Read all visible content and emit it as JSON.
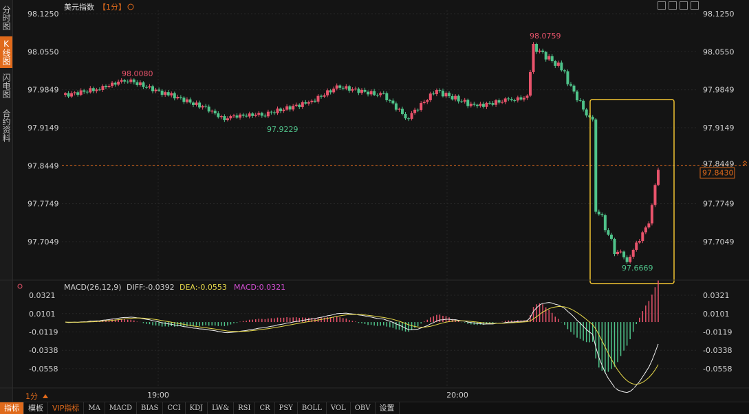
{
  "sidebar": {
    "tabs": [
      {
        "label": "分时图",
        "active": false
      },
      {
        "label": "K线图",
        "active": true
      },
      {
        "label": "闪电图",
        "active": false
      },
      {
        "label": "合约资料",
        "active": false
      }
    ]
  },
  "header": {
    "title": "美元指数",
    "period": "【1分】",
    "toolbar_icons": [
      "crosshair-icon",
      "split-icon",
      "fullscreen-icon",
      "menu-icon"
    ]
  },
  "price_axis": {
    "ticks": [
      "98.1250",
      "98.0550",
      "97.9849",
      "97.9149",
      "97.8449",
      "97.7749",
      "97.7049"
    ],
    "current_price": "97.8430",
    "dashed_level": "97.8449"
  },
  "annotations": {
    "high1": "98.0080",
    "low1": "97.9229",
    "high2": "98.0759",
    "low2": "97.6669"
  },
  "macd": {
    "label": "MACD(26,12,9)",
    "diff": "DIFF:-0.0392",
    "dea": "DEA:-0.0553",
    "macd": "MACD:0.0321",
    "ticks": [
      "0.0321",
      "0.0101",
      "-0.0119",
      "-0.0338",
      "-0.0558"
    ]
  },
  "time_axis": {
    "ticks": [
      "19:00",
      "20:00"
    ],
    "period_selector": "1分"
  },
  "bottom_toolbar": {
    "buttons": [
      "指标",
      "模板",
      "VIP指标",
      "MA",
      "MACD",
      "BIAS",
      "CCI",
      "KDJ",
      "LW&",
      "RSI",
      "CR",
      "PSY",
      "BOLL",
      "VOL",
      "OBV",
      "设置"
    ]
  },
  "colors": {
    "up": "#e8536b",
    "down": "#4fc38a",
    "accent": "#e06a1b",
    "highlight_box": "#f2c431",
    "dea_line": "#e6d84a",
    "macd_label": "#d44fd4"
  },
  "chart_data": {
    "type": "candlestick",
    "title": "美元指数【1分】",
    "ylim": [
      97.64,
      98.14
    ],
    "annotated_high_low": [
      98.008,
      97.9229,
      98.0759,
      97.6669
    ],
    "current_price": 97.843
  }
}
